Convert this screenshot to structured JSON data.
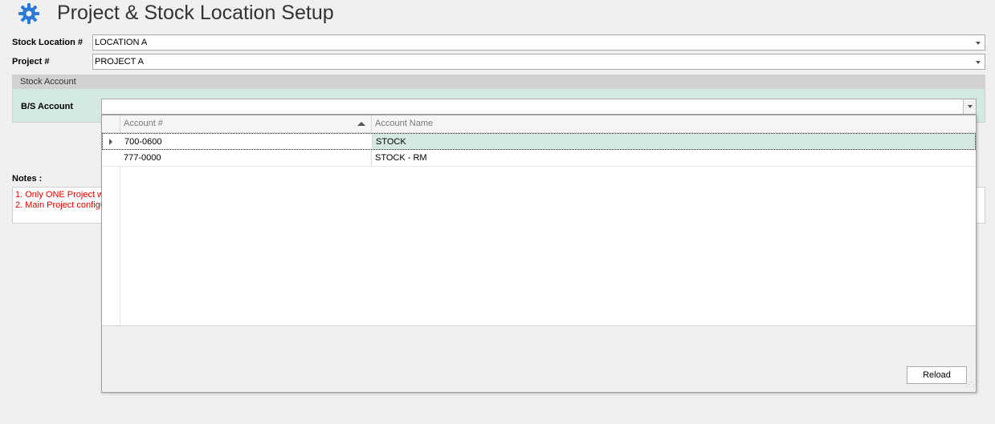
{
  "window": {
    "title": "Project & Stock Location Setup"
  },
  "form": {
    "stock_location_label": "Stock Location #",
    "stock_location_value": "LOCATION A",
    "project_label": "Project #",
    "project_value": "PROJECT A",
    "stock_account_group": "Stock Account",
    "bs_account_label": "B/S Account",
    "bs_account_value": ""
  },
  "notes": {
    "label": "Notes :",
    "lines": [
      "1. Only ONE Project w",
      "2. Main Project configu"
    ]
  },
  "lookup": {
    "columns": [
      "Account #",
      "Account Name"
    ],
    "rows": [
      {
        "account": "700-0600",
        "name": "STOCK",
        "selected": true
      },
      {
        "account": "777-0000",
        "name": "STOCK - RM",
        "selected": false
      }
    ],
    "reload_label": "Reload"
  },
  "colors": {
    "selected_row": "#d4e9e3",
    "notes_text": "#e00000",
    "gear_icon": "#2a7ad5"
  }
}
